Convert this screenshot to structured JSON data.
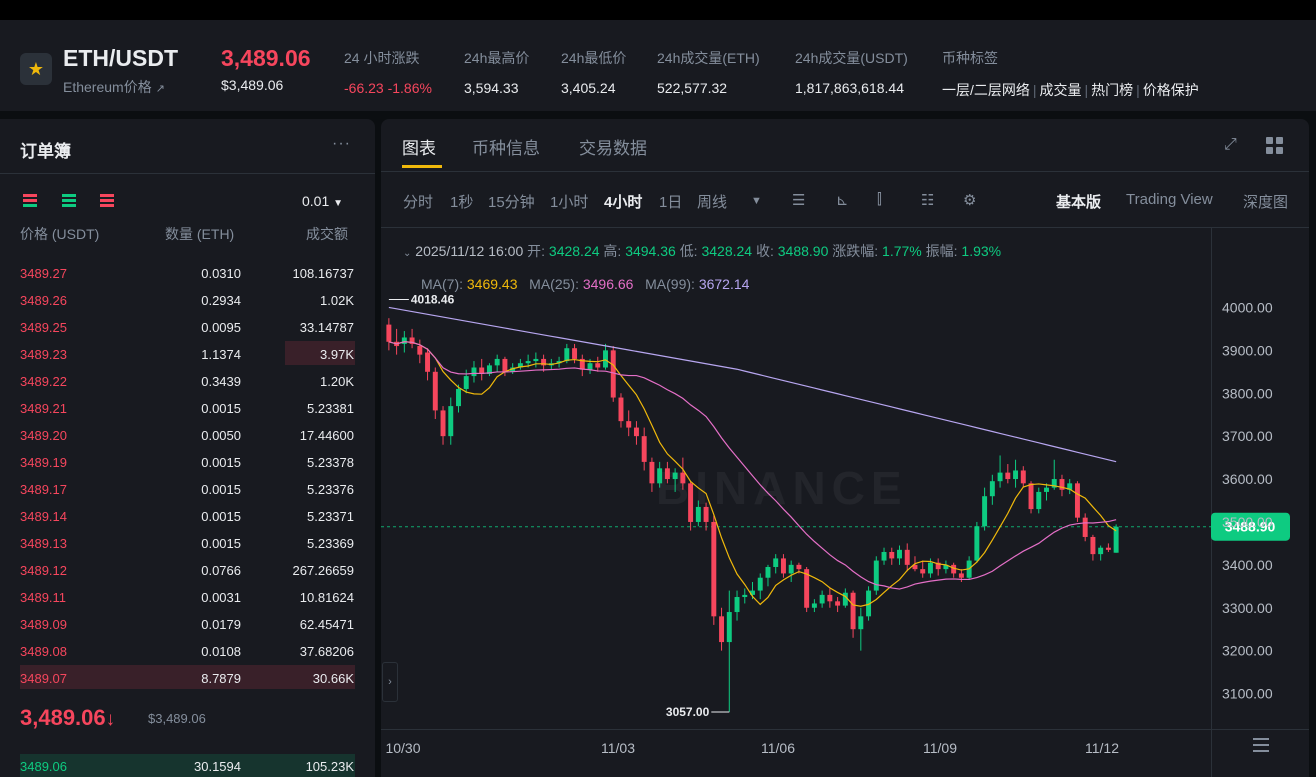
{
  "ticker": {
    "symbol": "ETH/USDT",
    "name": "Ethereum价格",
    "name_arrow": "↗",
    "last_price": "3,489.06",
    "last_price_usd": "$3,489.06",
    "stats": [
      {
        "label": "24 小时涨跌",
        "value": "-66.23 -1.86%",
        "tone": "down"
      },
      {
        "label": "24h最高价",
        "value": "3,594.33",
        "tone": "neutral"
      },
      {
        "label": "24h最低价",
        "value": "3,405.24",
        "tone": "neutral"
      },
      {
        "label": "24h成交量(ETH)",
        "value": "522,577.32",
        "tone": "neutral"
      },
      {
        "label": "24h成交量(USDT)",
        "value": "1,817,863,618.44",
        "tone": "neutral"
      }
    ],
    "tags_label": "币种标签",
    "tags": [
      "一层/二层网络",
      "成交量",
      "热门榜",
      "价格保护"
    ]
  },
  "orderbook": {
    "title": "订单簿",
    "more": "···",
    "precision": "0.01",
    "headers": {
      "price": "价格 (USDT)",
      "qty": "数量 (ETH)",
      "total": "成交额"
    },
    "asks": [
      {
        "price": "3489.27",
        "qty": "0.0310",
        "total": "108.16737",
        "depth": 0
      },
      {
        "price": "3489.26",
        "qty": "0.2934",
        "total": "1.02K",
        "depth": 0
      },
      {
        "price": "3489.25",
        "qty": "0.0095",
        "total": "33.14787",
        "depth": 0
      },
      {
        "price": "3489.23",
        "qty": "1.1374",
        "total": "3.97K",
        "depth": 0.2
      },
      {
        "price": "3489.22",
        "qty": "0.3439",
        "total": "1.20K",
        "depth": 0
      },
      {
        "price": "3489.21",
        "qty": "0.0015",
        "total": "5.23381",
        "depth": 0
      },
      {
        "price": "3489.20",
        "qty": "0.0050",
        "total": "17.44600",
        "depth": 0
      },
      {
        "price": "3489.19",
        "qty": "0.0015",
        "total": "5.23378",
        "depth": 0
      },
      {
        "price": "3489.17",
        "qty": "0.0015",
        "total": "5.23376",
        "depth": 0
      },
      {
        "price": "3489.14",
        "qty": "0.0015",
        "total": "5.23371",
        "depth": 0
      },
      {
        "price": "3489.13",
        "qty": "0.0015",
        "total": "5.23369",
        "depth": 0
      },
      {
        "price": "3489.12",
        "qty": "0.0766",
        "total": "267.26659",
        "depth": 0
      },
      {
        "price": "3489.11",
        "qty": "0.0031",
        "total": "10.81624",
        "depth": 0
      },
      {
        "price": "3489.09",
        "qty": "0.0179",
        "total": "62.45471",
        "depth": 0
      },
      {
        "price": "3489.08",
        "qty": "0.0108",
        "total": "37.68206",
        "depth": 0
      },
      {
        "price": "3489.07",
        "qty": "8.7879",
        "total": "30.66K",
        "depth": 1.0
      }
    ],
    "last_price": "3,489.06",
    "last_arrow": "↓",
    "last_price_usd": "$3,489.06",
    "bid": {
      "price": "3489.06",
      "qty": "30.1594",
      "total": "105.23K"
    }
  },
  "chart_panel": {
    "tabs": [
      "图表",
      "币种信息",
      "交易数据"
    ],
    "active_tab": 0,
    "intervals": [
      "分时",
      "1秒",
      "15分钟",
      "1小时",
      "4小时",
      "1日",
      "周线"
    ],
    "active_interval": 4,
    "versions": [
      "基本版",
      "Trading View",
      "深度图"
    ],
    "ohlc": {
      "time": "2025/11/12 16:00",
      "open_label": "开:",
      "open": "3428.24",
      "high_label": "高:",
      "high": "3494.36",
      "low_label": "低:",
      "low": "3428.24",
      "close_label": "收:",
      "close": "3488.90",
      "change_label": "涨跌幅:",
      "change": "1.77%",
      "amp_label": "振幅:",
      "amp": "1.93%"
    },
    "ma_legend": [
      {
        "label": "MA(7):",
        "value": "3469.43",
        "color": "#f0b90b"
      },
      {
        "label": "MA(25):",
        "value": "3496.66",
        "color": "#e46fc7"
      },
      {
        "label": "MA(99):",
        "value": "3672.14",
        "color": "#b7a6f0"
      }
    ],
    "watermark": "BINANCE"
  },
  "chart_data": {
    "type": "candlestick",
    "interval": "4h",
    "y_ticks": [
      "4000.00",
      "3900.00",
      "3800.00",
      "3700.00",
      "3600.00",
      "3500.00",
      "3400.00",
      "3300.00",
      "3200.00",
      "3100.00"
    ],
    "ylim": [
      3050,
      4050
    ],
    "x_ticks": [
      "10/30",
      "11/03",
      "11/06",
      "11/09",
      "11/12"
    ],
    "current_price": "3488.90",
    "high_marker": "4018.46",
    "low_marker": "3057.00",
    "candles": [
      [
        3960,
        3975,
        3900,
        3920
      ],
      [
        3920,
        3950,
        3890,
        3910
      ],
      [
        3915,
        3945,
        3895,
        3930
      ],
      [
        3930,
        3950,
        3905,
        3915
      ],
      [
        3910,
        3925,
        3870,
        3890
      ],
      [
        3895,
        3905,
        3830,
        3850
      ],
      [
        3850,
        3860,
        3740,
        3760
      ],
      [
        3760,
        3770,
        3680,
        3700
      ],
      [
        3700,
        3790,
        3680,
        3770
      ],
      [
        3770,
        3820,
        3755,
        3810
      ],
      [
        3810,
        3855,
        3800,
        3840
      ],
      [
        3840,
        3875,
        3825,
        3860
      ],
      [
        3860,
        3880,
        3830,
        3845
      ],
      [
        3845,
        3870,
        3840,
        3865
      ],
      [
        3865,
        3890,
        3850,
        3880
      ],
      [
        3880,
        3885,
        3840,
        3850
      ],
      [
        3850,
        3870,
        3845,
        3860
      ],
      [
        3860,
        3880,
        3855,
        3870
      ],
      [
        3870,
        3890,
        3860,
        3875
      ],
      [
        3875,
        3895,
        3860,
        3880
      ],
      [
        3880,
        3890,
        3850,
        3865
      ],
      [
        3865,
        3880,
        3855,
        3870
      ],
      [
        3870,
        3885,
        3860,
        3875
      ],
      [
        3875,
        3915,
        3870,
        3905
      ],
      [
        3905,
        3915,
        3870,
        3880
      ],
      [
        3880,
        3890,
        3840,
        3855
      ],
      [
        3855,
        3880,
        3845,
        3870
      ],
      [
        3870,
        3885,
        3850,
        3860
      ],
      [
        3860,
        3915,
        3855,
        3900
      ],
      [
        3900,
        3910,
        3780,
        3790
      ],
      [
        3790,
        3800,
        3720,
        3735
      ],
      [
        3735,
        3760,
        3700,
        3720
      ],
      [
        3720,
        3735,
        3680,
        3700
      ],
      [
        3700,
        3720,
        3620,
        3640
      ],
      [
        3640,
        3650,
        3570,
        3590
      ],
      [
        3590,
        3640,
        3580,
        3625
      ],
      [
        3625,
        3640,
        3590,
        3600
      ],
      [
        3600,
        3625,
        3570,
        3615
      ],
      [
        3615,
        3650,
        3575,
        3590
      ],
      [
        3590,
        3595,
        3480,
        3500
      ],
      [
        3500,
        3550,
        3490,
        3535
      ],
      [
        3535,
        3545,
        3480,
        3500
      ],
      [
        3500,
        3515,
        3260,
        3280
      ],
      [
        3280,
        3300,
        3200,
        3220
      ],
      [
        3220,
        3340,
        3057,
        3290
      ],
      [
        3290,
        3340,
        3270,
        3325
      ],
      [
        3325,
        3345,
        3310,
        3330
      ],
      [
        3330,
        3360,
        3320,
        3340
      ],
      [
        3340,
        3380,
        3320,
        3370
      ],
      [
        3370,
        3400,
        3350,
        3395
      ],
      [
        3395,
        3425,
        3380,
        3415
      ],
      [
        3415,
        3425,
        3370,
        3380
      ],
      [
        3380,
        3410,
        3360,
        3400
      ],
      [
        3400,
        3405,
        3380,
        3390
      ],
      [
        3390,
        3395,
        3290,
        3300
      ],
      [
        3300,
        3320,
        3290,
        3310
      ],
      [
        3310,
        3340,
        3300,
        3330
      ],
      [
        3330,
        3345,
        3300,
        3315
      ],
      [
        3315,
        3325,
        3290,
        3305
      ],
      [
        3305,
        3345,
        3300,
        3335
      ],
      [
        3335,
        3340,
        3230,
        3250
      ],
      [
        3250,
        3300,
        3200,
        3280
      ],
      [
        3280,
        3350,
        3270,
        3340
      ],
      [
        3340,
        3420,
        3330,
        3410
      ],
      [
        3410,
        3440,
        3400,
        3430
      ],
      [
        3430,
        3440,
        3400,
        3415
      ],
      [
        3415,
        3445,
        3400,
        3435
      ],
      [
        3435,
        3450,
        3385,
        3400
      ],
      [
        3400,
        3420,
        3385,
        3390
      ],
      [
        3390,
        3410,
        3370,
        3380
      ],
      [
        3380,
        3415,
        3370,
        3405
      ],
      [
        3405,
        3415,
        3375,
        3390
      ],
      [
        3390,
        3410,
        3380,
        3400
      ],
      [
        3400,
        3405,
        3370,
        3380
      ],
      [
        3380,
        3390,
        3360,
        3370
      ],
      [
        3370,
        3420,
        3365,
        3410
      ],
      [
        3410,
        3500,
        3405,
        3490
      ],
      [
        3490,
        3580,
        3480,
        3560
      ],
      [
        3560,
        3610,
        3540,
        3595
      ],
      [
        3595,
        3655,
        3580,
        3615
      ],
      [
        3615,
        3635,
        3590,
        3600
      ],
      [
        3600,
        3645,
        3580,
        3620
      ],
      [
        3620,
        3630,
        3580,
        3590
      ],
      [
        3590,
        3595,
        3520,
        3530
      ],
      [
        3530,
        3580,
        3520,
        3570
      ],
      [
        3570,
        3590,
        3550,
        3580
      ],
      [
        3580,
        3645,
        3575,
        3600
      ],
      [
        3600,
        3610,
        3560,
        3575
      ],
      [
        3575,
        3600,
        3565,
        3590
      ],
      [
        3590,
        3595,
        3500,
        3510
      ],
      [
        3510,
        3520,
        3455,
        3465
      ],
      [
        3465,
        3470,
        3410,
        3425
      ],
      [
        3425,
        3445,
        3410,
        3440
      ],
      [
        3440,
        3450,
        3430,
        3435
      ],
      [
        3428.24,
        3494.36,
        3428.24,
        3488.9
      ]
    ]
  }
}
